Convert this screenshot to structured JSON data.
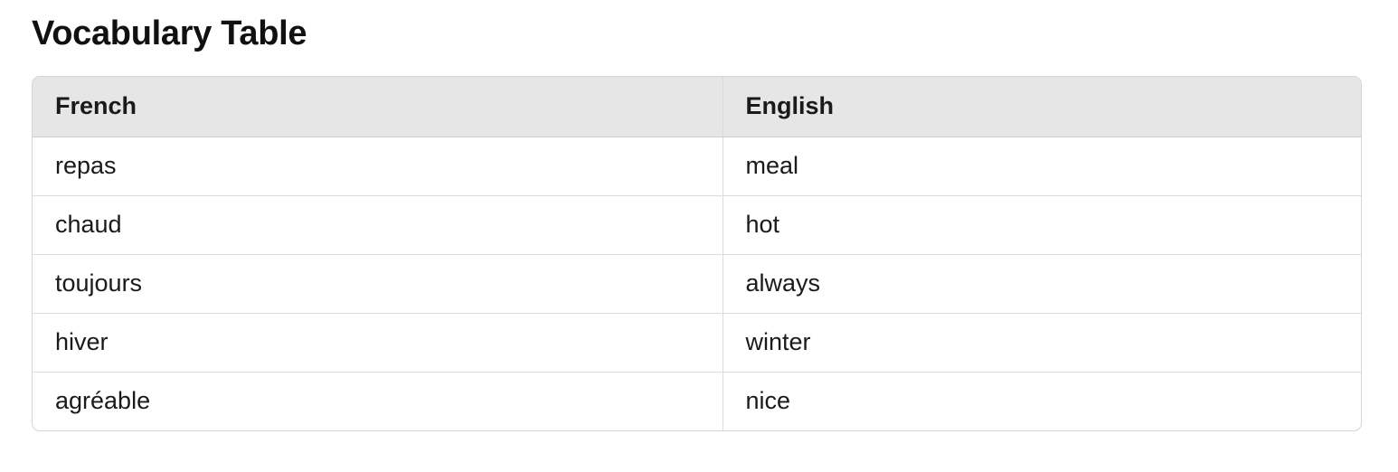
{
  "page": {
    "title": "Vocabulary Table"
  },
  "table": {
    "headers": [
      "French",
      "English"
    ],
    "rows": [
      [
        "repas",
        "meal"
      ],
      [
        "chaud",
        "hot"
      ],
      [
        "toujours",
        "always"
      ],
      [
        "hiver",
        "winter"
      ],
      [
        "agréable",
        "nice"
      ]
    ]
  },
  "colors": {
    "header_background": "#e6e6e6",
    "border": "#d4d4d4",
    "text": "#111111"
  }
}
